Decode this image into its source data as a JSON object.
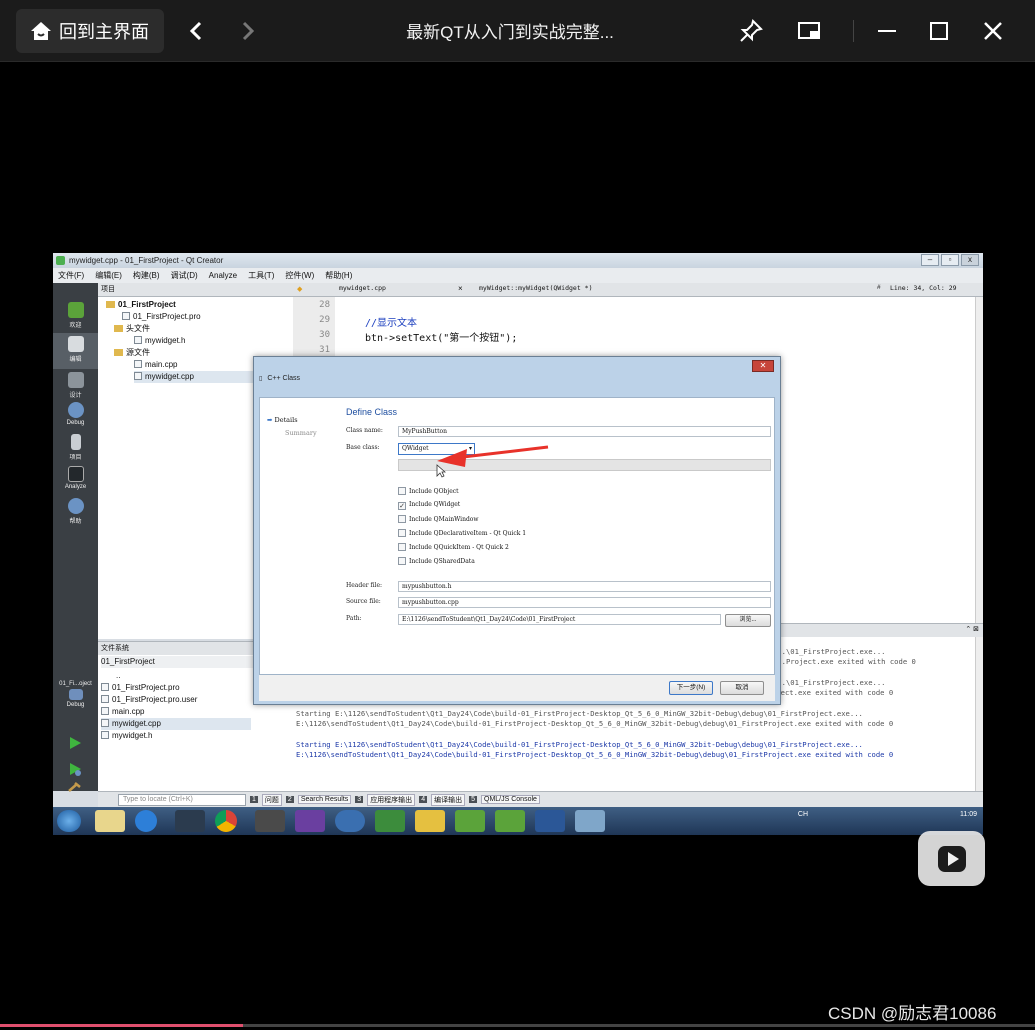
{
  "player": {
    "home_label": "回到主界面",
    "title": "最新QT从入门到实战完整...",
    "watermark": "CSDN @励志君10086",
    "progress": 0.235
  },
  "qt": {
    "window_title": "mywidget.cpp - 01_FirstProject - Qt Creator",
    "menu": [
      "文件(F)",
      "编辑(E)",
      "构建(B)",
      "调试(D)",
      "Analyze",
      "工具(T)",
      "控件(W)",
      "帮助(H)"
    ],
    "modes": [
      "欢迎",
      "编辑",
      "设计",
      "Debug",
      "项目",
      "Analyze",
      "帮助"
    ],
    "kit_label": "01_Fi...oject",
    "kit_sublabel": "Debug",
    "projects_header": "项目",
    "project_tree": {
      "root": "01_FirstProject",
      "pro": "01_FirstProject.pro",
      "headers_folder": "头文件",
      "header_file": "mywidget.h",
      "sources_folder": "源文件",
      "main_cpp": "main.cpp",
      "widget_cpp": "mywidget.cpp"
    },
    "filesystem_header": "文件系统",
    "filesystem": {
      "current_dir": "01_FirstProject",
      "up": "..",
      "items": [
        "01_FirstProject.pro",
        "01_FirstProject.pro.user",
        "main.cpp",
        "mywidget.cpp",
        "mywidget.h"
      ]
    },
    "editor": {
      "file_tab": "mywidget.cpp",
      "symbol": "myWidget::myWidget(QWidget *)",
      "position": "Line: 34, Col: 29",
      "hash": "#",
      "line_numbers": [
        "28",
        "29",
        "30",
        "31"
      ],
      "code_comment": "//显示文本",
      "code_line": "btn->setText(\"第一个按钮\");"
    },
    "output_lines": [
      "...\\01_FirstProject.exe...",
      "...Project.exe exited with code 0",
      "...\\01_FirstProject.exe...",
      "E:\\1126\\sendToStudent\\Qt1_Day24\\Code\\build-01_FirstProject-Desktop_Qt_5_6_0_MinGW_32bit-Debug\\debug\\01_FirstProject.exe exited with code 0",
      "Starting E:\\1126\\sendToStudent\\Qt1_Day24\\Code\\build-01_FirstProject-Desktop_Qt_5_6_0_MinGW_32bit-Debug\\debug\\01_FirstProject.exe...",
      "E:\\1126\\sendToStudent\\Qt1_Day24\\Code\\build-01_FirstProject-Desktop_Qt_5_6_0_MinGW_32bit-Debug\\debug\\01_FirstProject.exe exited with code 0",
      "Starting E:\\1126\\sendToStudent\\Qt1_Day24\\Code\\build-01_FirstProject-Desktop_Qt_5_6_0_MinGW_32bit-Debug\\debug\\01_FirstProject.exe...",
      "E:\\1126\\sendToStudent\\Qt1_Day24\\Code\\build-01_FirstProject-Desktop_Qt_5_6_0_MinGW_32bit-Debug\\debug\\01_FirstProject.exe exited with code 0"
    ],
    "status": {
      "locate_placeholder": "Type to locate (Ctrl+K)",
      "tabs": [
        {
          "num": "1",
          "label": "问题"
        },
        {
          "num": "2",
          "label": "Search Results"
        },
        {
          "num": "3",
          "label": "应用程序输出"
        },
        {
          "num": "4",
          "label": "编译输出"
        },
        {
          "num": "5",
          "label": "QML/JS Console"
        }
      ]
    },
    "tray": {
      "time": "11:09",
      "lang": "CH"
    }
  },
  "dialog": {
    "title": "C++ Class",
    "close": "✕",
    "steps": [
      "Details",
      "Summary"
    ],
    "heading": "Define Class",
    "class_name_label": "Class name:",
    "class_name": "MyPushButton",
    "base_class_label": "Base class:",
    "base_class": "QWidget",
    "checkboxes": [
      {
        "label": "Include QObject",
        "checked": false
      },
      {
        "label": "Include QWidget",
        "checked": true
      },
      {
        "label": "Include QMainWindow",
        "checked": false
      },
      {
        "label": "Include QDeclarativeItem - Qt Quick 1",
        "checked": false
      },
      {
        "label": "Include QQuickItem - Qt Quick 2",
        "checked": false
      },
      {
        "label": "Include QSharedData",
        "checked": false
      }
    ],
    "header_file_label": "Header file:",
    "header_file": "mypushbutton.h",
    "source_file_label": "Source file:",
    "source_file": "mypushbutton.cpp",
    "path_label": "Path:",
    "path": "E:\\1126\\sendToStudent\\Qt1_Day24\\Code\\01_FirstProject",
    "browse": "浏览...",
    "next": "下一步(N)",
    "cancel": "取消"
  },
  "colors": {
    "accent": "#1f4fa0",
    "arrow": "#e8322a",
    "progress": "#e0506f"
  }
}
